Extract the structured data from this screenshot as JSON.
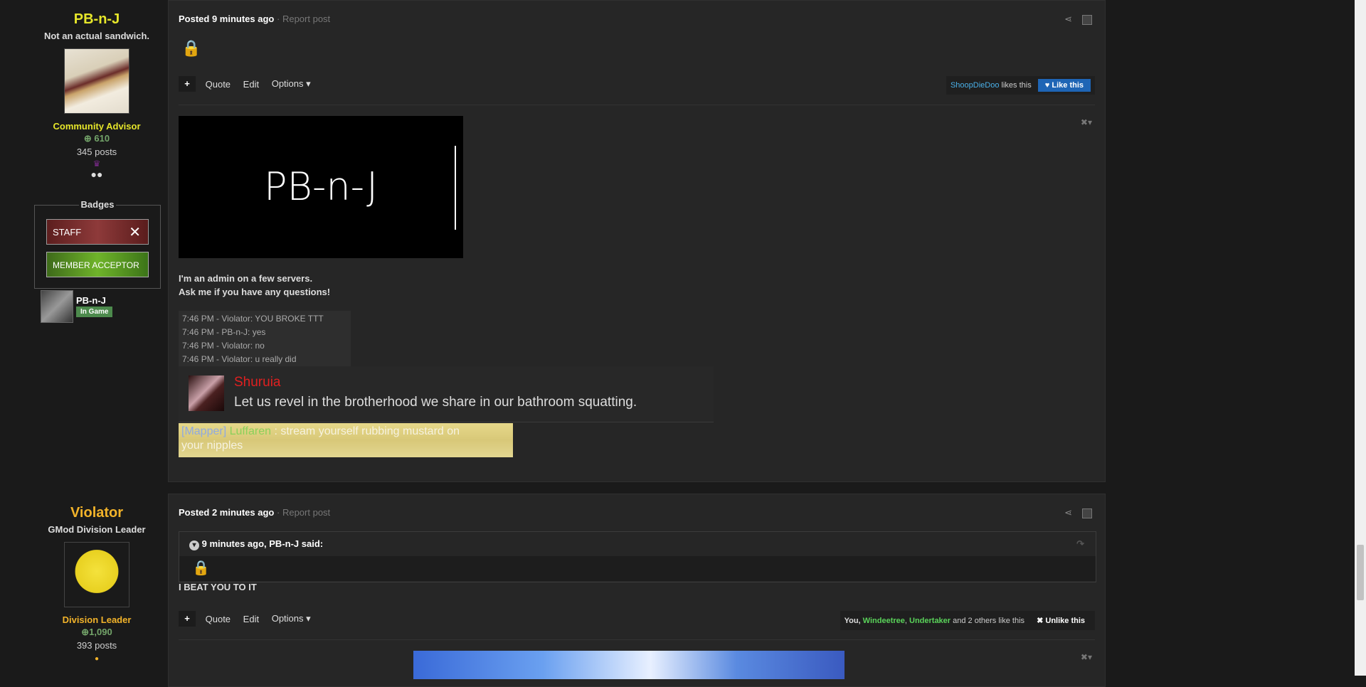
{
  "post1": {
    "author": {
      "name": "PB-n-J",
      "title": "Not an actual sandwich.",
      "rank": "Community Advisor",
      "rep": "610",
      "posts": "345 posts",
      "name_color": "#e6e62a"
    },
    "badges_label": "Badges",
    "badges": [
      "STAFF",
      "MEMBER ACCEPTOR"
    ],
    "steam": {
      "name": "PB-n-J",
      "status": "In Game"
    },
    "meta": {
      "posted": "Posted 9 minutes ago",
      "report": "Report post"
    },
    "actions": {
      "quote": "Quote",
      "edit": "Edit",
      "options": "Options"
    },
    "likes": {
      "user": "ShoopDieDoo",
      "suffix": "likes this",
      "button": "Like this"
    },
    "signature": {
      "banner_text": "PB-n-J",
      "line1": "I'm an admin on a few servers.",
      "line2": "Ask me if you have any questions!",
      "chat": [
        "7:46 PM - Violator: YOU BROKE TTT",
        "7:46 PM - PB-n-J: yes",
        "7:46 PM - Violator: no",
        "7:46 PM - Violator: u really did"
      ],
      "quote_name": "Shuruia",
      "quote_text": "Let us revel in the brotherhood we share in our bathroom squatting.",
      "chat2_tag": "[Mapper]",
      "chat2_name": "Luffaren",
      "chat2_text": ":  stream yourself rubbing mustard on",
      "chat2_text2": "your nipples"
    }
  },
  "post2": {
    "author": {
      "name": "Violator",
      "title": "GMod Division Leader",
      "rank": "Division Leader",
      "rep": "1,090",
      "posts": "393 posts",
      "name_color": "#f2b32a"
    },
    "meta": {
      "posted": "Posted 2 minutes ago",
      "report": "Report post"
    },
    "quote_header": "9 minutes ago, PB-n-J said:",
    "body": "I BEAT YOU TO IT",
    "actions": {
      "quote": "Quote",
      "edit": "Edit",
      "options": "Options"
    },
    "likes": {
      "you": "You,",
      "user1": "Windeetree",
      "comma": ",",
      "user2": "Undertaker",
      "rest": "and 2 others like this",
      "button": "Unlike this"
    }
  }
}
